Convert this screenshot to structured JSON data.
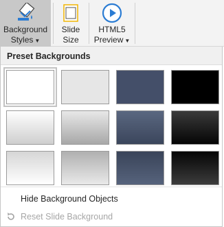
{
  "ribbon": {
    "background_styles": {
      "line1": "Background",
      "line2": "Styles",
      "icon": "paint-bucket-icon"
    },
    "slide_size": {
      "line1": "Slide",
      "line2": "Size",
      "icon": "slide-size-icon"
    },
    "html5_preview": {
      "line1": "HTML5",
      "line2": "Preview",
      "icon": "play-circle-icon"
    }
  },
  "dropdown": {
    "header": "Preset Backgrounds",
    "presets": [
      {
        "row": 1,
        "style": "white",
        "selected": true
      },
      {
        "row": 1,
        "style": "light-gray"
      },
      {
        "row": 1,
        "style": "slate-blue"
      },
      {
        "row": 1,
        "style": "black"
      },
      {
        "row": 2,
        "style": "white-gradient"
      },
      {
        "row": 2,
        "style": "gray-gradient"
      },
      {
        "row": 2,
        "style": "slate-gradient"
      },
      {
        "row": 2,
        "style": "black-gradient"
      },
      {
        "row": 3,
        "style": "white-gradient-reverse"
      },
      {
        "row": 3,
        "style": "gray-gradient-reverse"
      },
      {
        "row": 3,
        "style": "slate-gradient-dark"
      },
      {
        "row": 3,
        "style": "black-gradient-reverse"
      }
    ],
    "hide_background_objects": "Hide Background Objects",
    "reset_slide_background": "Reset Slide Background",
    "reset_disabled": true
  },
  "colors": {
    "accent_blue": "#2b7cd3",
    "active_button": "#c8c8c8",
    "slate": "#3f4c66",
    "disabled_text": "#a6a6a6"
  }
}
